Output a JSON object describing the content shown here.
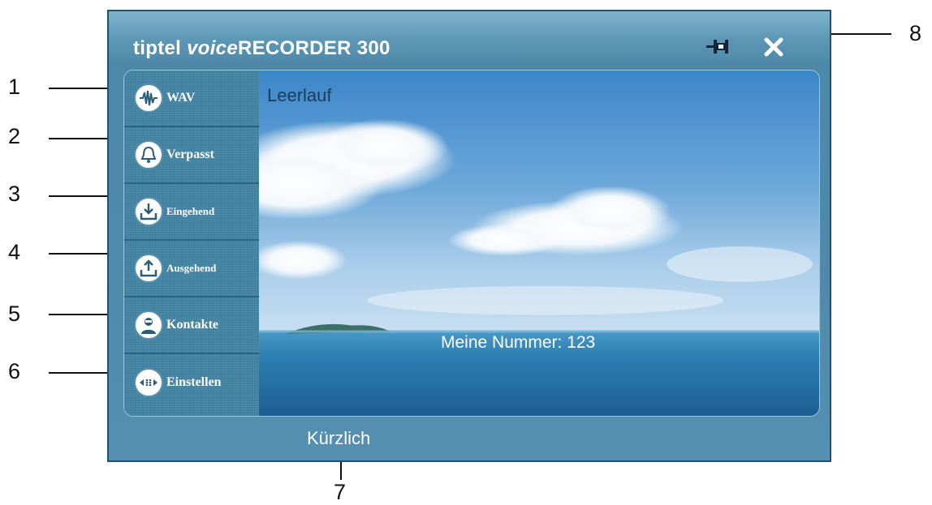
{
  "callouts": [
    "1",
    "2",
    "3",
    "4",
    "5",
    "6",
    "7",
    "8"
  ],
  "window": {
    "title_brand": "tiptel ",
    "title_voice": "voice",
    "title_model": "RECORDER 300"
  },
  "status": "Leerlauf",
  "my_number": "Meine Nummer: 123",
  "bottom_tab": "Kürzlich",
  "sidebar": {
    "items": [
      {
        "label": "WAV",
        "icon": "waveform-icon"
      },
      {
        "label": "Verpasst",
        "icon": "bell-icon"
      },
      {
        "label": "Eingehend",
        "icon": "download-tray-icon"
      },
      {
        "label": "Ausgehend",
        "icon": "upload-tray-icon"
      },
      {
        "label": "Kontakte",
        "icon": "contact-person-icon"
      },
      {
        "label": "Einstellen",
        "icon": "settings-dial-icon"
      }
    ]
  },
  "colors": {
    "window": "#4d88a8",
    "sidebar": "#3f7f9f",
    "status_text": "#1b3d58"
  }
}
